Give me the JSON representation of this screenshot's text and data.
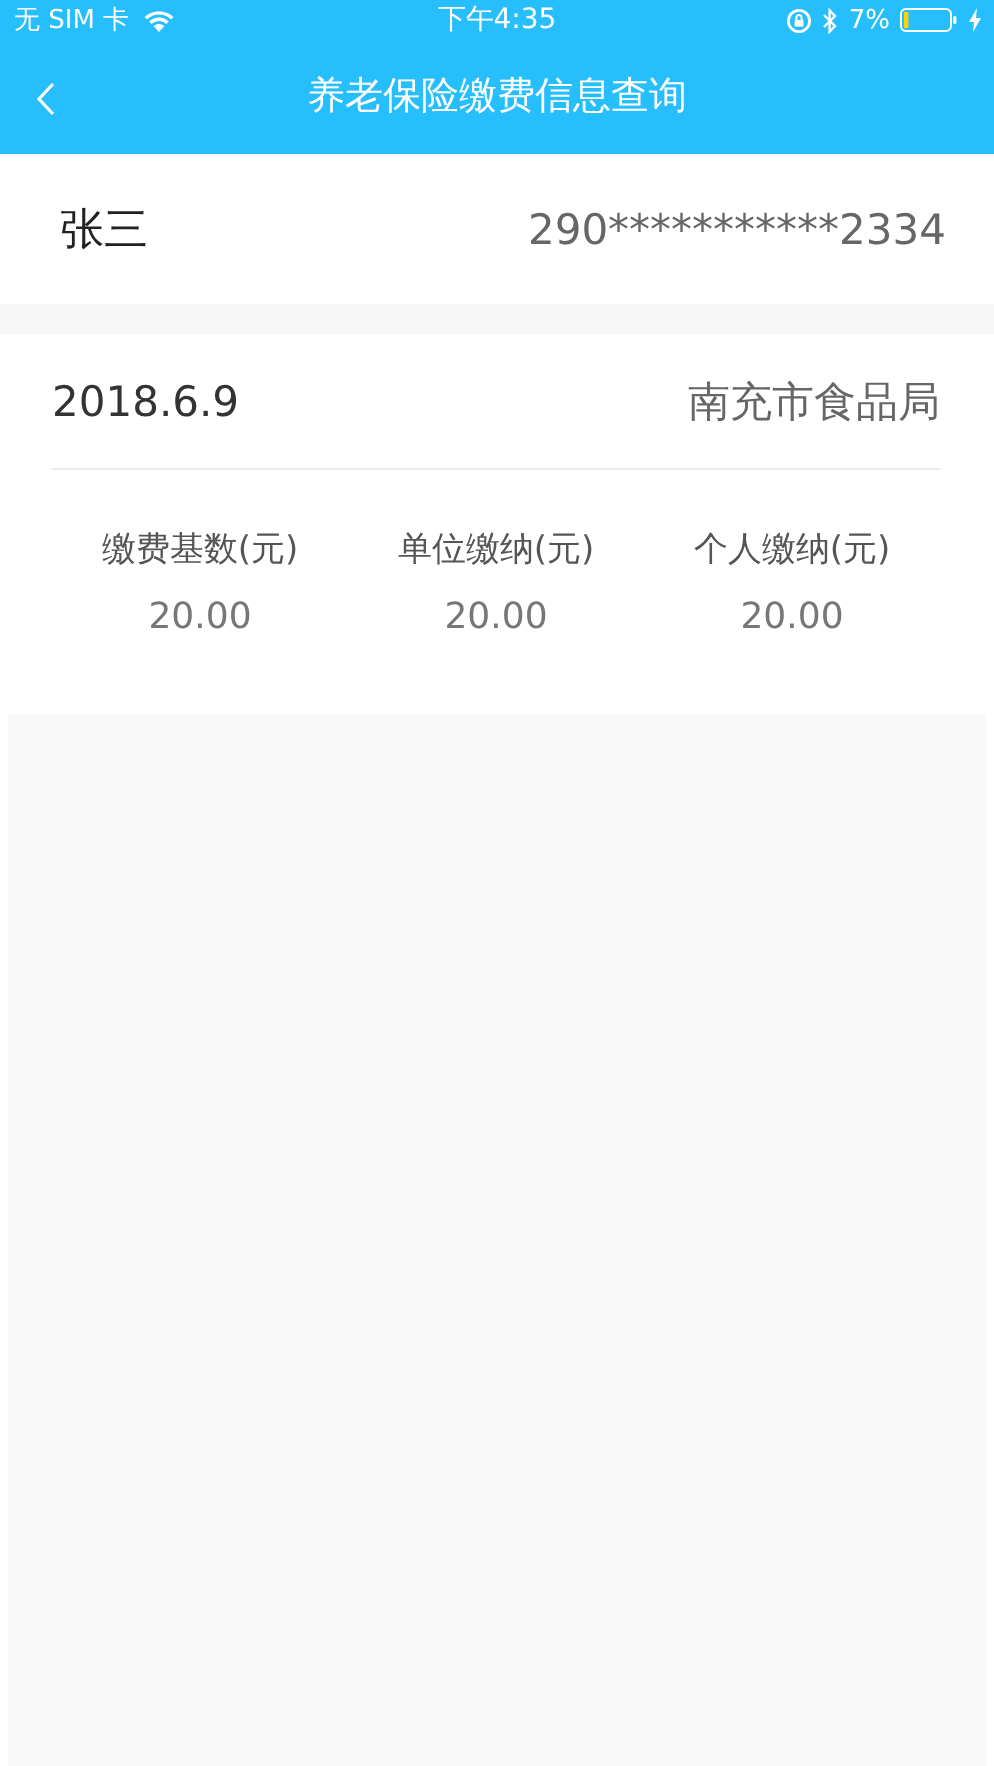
{
  "status_bar": {
    "carrier": "无 SIM 卡",
    "time": "下午4:35",
    "battery": "7%"
  },
  "nav": {
    "title": "养老保险缴费信息查询"
  },
  "person": {
    "name": "张三",
    "id_number": "290***********2334"
  },
  "records": [
    {
      "date": "2018.6.9",
      "unit": "南充市食品局",
      "amounts": [
        {
          "label": "缴费基数(元)",
          "value": "20.00"
        },
        {
          "label": "单位缴纳(元)",
          "value": "20.00"
        },
        {
          "label": "个人缴纳(元)",
          "value": "20.00"
        }
      ]
    }
  ]
}
